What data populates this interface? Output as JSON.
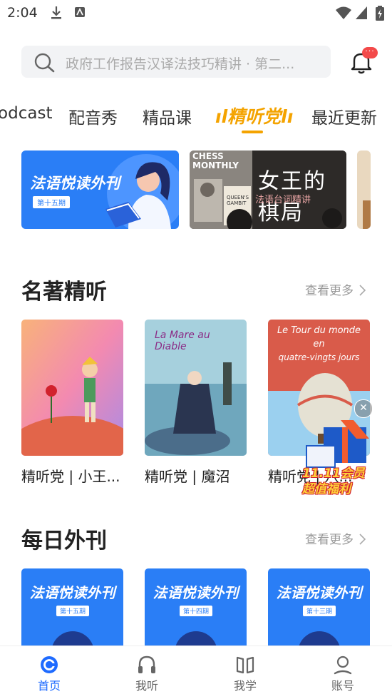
{
  "status_bar": {
    "time": "2:04"
  },
  "search": {
    "placeholder": "政府工作报告汉译法技巧精讲 · 第二..."
  },
  "notification": {
    "badge": "···"
  },
  "tabs": [
    {
      "label": "Podcast"
    },
    {
      "label": "配音秀"
    },
    {
      "label": "精品课"
    },
    {
      "label": "精听党"
    },
    {
      "label": "最近更新"
    }
  ],
  "banners": [
    {
      "title": "法语悦读外刊",
      "issue": "第十五期"
    },
    {
      "title_main": "女王的棋局",
      "subtitle": "法语台词精讲",
      "chess_text": "CHESS MONTHLY",
      "book_text": "QUEEN'S GAMBIT"
    }
  ],
  "section_classics": {
    "title": "名著精听",
    "more": "查看更多",
    "books": [
      {
        "title": "精听党 | 小王..."
      },
      {
        "title": "精听党 | 魔沼",
        "cover_text": "La Mare au Diable"
      },
      {
        "title": "精听党 | 八...",
        "cover_text_1": "Le Tour du monde",
        "cover_text_2": "en",
        "cover_text_3": "quatre-vingts jours"
      }
    ]
  },
  "promo": {
    "line1": "11.11会员",
    "line2": "超值福利"
  },
  "section_journals": {
    "title": "每日外刊",
    "more": "查看更多",
    "items": [
      {
        "title": "法语悦读外刊",
        "issue": "第十五期"
      },
      {
        "title": "法语悦读外刊",
        "issue": "第十四期"
      },
      {
        "title": "法语悦读外刊",
        "issue": "第十三期"
      }
    ]
  },
  "bottom_nav": [
    {
      "label": "首页"
    },
    {
      "label": "我听"
    },
    {
      "label": "我学"
    },
    {
      "label": "账号"
    }
  ],
  "colors": {
    "accent": "#1f6bff",
    "tab_active": "#f4a300",
    "journal_blue": "#2a7ef6"
  }
}
